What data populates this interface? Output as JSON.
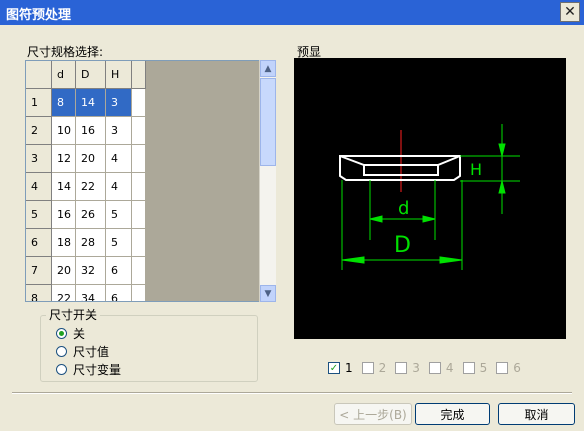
{
  "window": {
    "title": "图符预处理",
    "close_glyph": "✕"
  },
  "size_select": {
    "label": "尺寸规格选择:",
    "columns": [
      "d",
      "D",
      "H"
    ],
    "rows": [
      {
        "num": "1",
        "d": "8",
        "D": "14",
        "H": "3",
        "selected": true
      },
      {
        "num": "2",
        "d": "10",
        "D": "16",
        "H": "3"
      },
      {
        "num": "3",
        "d": "12",
        "D": "20",
        "H": "4"
      },
      {
        "num": "4",
        "d": "14",
        "D": "22",
        "H": "4"
      },
      {
        "num": "5",
        "d": "16",
        "D": "26",
        "H": "5"
      },
      {
        "num": "6",
        "d": "18",
        "D": "28",
        "H": "5"
      },
      {
        "num": "7",
        "d": "20",
        "D": "32",
        "H": "6"
      },
      {
        "num": "8",
        "d": "22",
        "D": "34",
        "H": "6"
      }
    ]
  },
  "preview": {
    "label": "预显",
    "dims": {
      "d": "d",
      "D": "D",
      "H": "H"
    }
  },
  "size_switch": {
    "title": "尺寸开关",
    "options": [
      {
        "label": "关",
        "checked": true
      },
      {
        "label": "尺寸值",
        "checked": false
      },
      {
        "label": "尺寸变量",
        "checked": false
      }
    ]
  },
  "views": [
    {
      "label": "1",
      "checked": true,
      "enabled": true
    },
    {
      "label": "2",
      "checked": false,
      "enabled": false
    },
    {
      "label": "3",
      "checked": false,
      "enabled": false
    },
    {
      "label": "4",
      "checked": false,
      "enabled": false
    },
    {
      "label": "5",
      "checked": false,
      "enabled": false
    },
    {
      "label": "6",
      "checked": false,
      "enabled": false
    }
  ],
  "buttons": {
    "prev": "< 上一步(B)",
    "finish": "完成",
    "cancel": "取消"
  }
}
